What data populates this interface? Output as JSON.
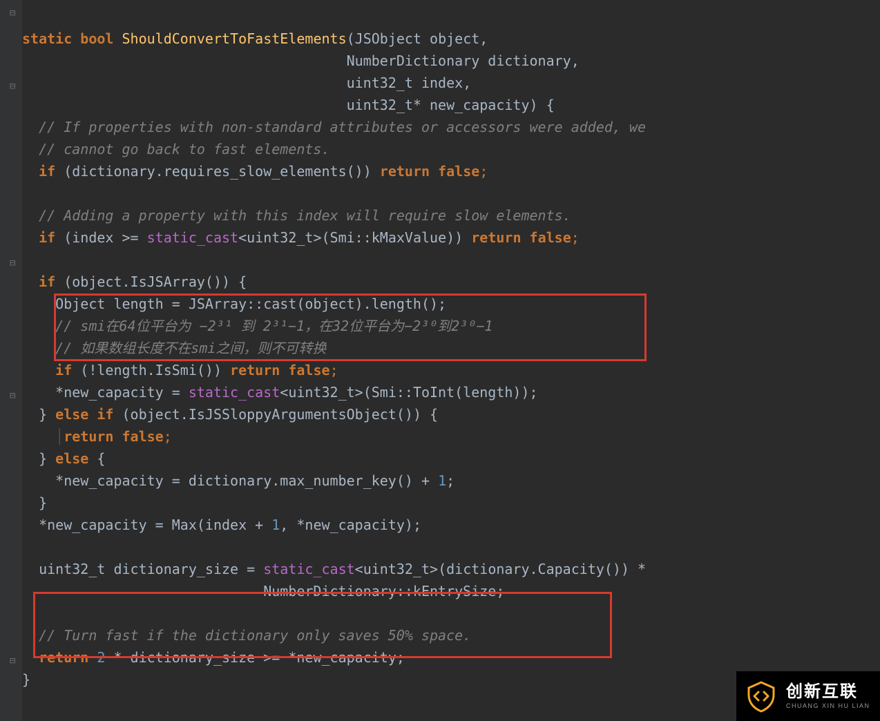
{
  "code": {
    "l1_a": "static",
    "l1_b": "bool",
    "l1_c": "ShouldConvertToFastElements",
    "l1_d": "(JSObject object,",
    "l2": "                                       NumberDictionary dictionary,",
    "l3": "                                       uint32_t index,",
    "l4": "                                       uint32_t* new_capacity) {",
    "l5": "  // If properties with non-standard attributes or accessors were added, we",
    "l6": "  // cannot go back to fast elements.",
    "l7a": "if",
    "l7b": " (dictionary.requires_slow_elements()) ",
    "l7c": "return",
    "l7d": "false",
    "l7e": ";",
    "l8": "",
    "l9": "  // Adding a property with this index will require slow elements.",
    "l10a": "if",
    "l10b": " (index >= ",
    "l10c": "static_cast",
    "l10d": "<uint32_t>(Smi::kMaxValue)) ",
    "l10e": "return",
    "l10f": "false",
    "l10g": ";",
    "l11": "",
    "l12a": "if",
    "l12b": " (object.IsJSArray()) {",
    "l13": "    Object length = JSArray::cast(object).length();",
    "l14": "    // smi在64位平台为 −2³¹ 到 2³¹−1，在32位平台为−2³⁰到2³⁰−1",
    "l15": "    // 如果数组长度不在smi之间，则不可转换",
    "l16a": "if",
    "l16b": " (!length.IsSmi()) ",
    "l16c": "return",
    "l16d": "false",
    "l16e": ";",
    "l17a": "    *new_capacity = ",
    "l17b": "static_cast",
    "l17c": "<uint32_t>(Smi::ToInt(length));",
    "l18a": "  } ",
    "l18b": "else if",
    "l18c": " (object.IsJSSloppyArgumentsObject()) {",
    "l19a": "return",
    "l19b": "false",
    "l19c": ";",
    "l20a": "  } ",
    "l20b": "else",
    "l20c": " {",
    "l21a": "    *new_capacity = dictionary.max_number_key() + ",
    "l21b": "1",
    "l21c": ";",
    "l22": "  }",
    "l23a": "  *new_capacity = Max(index + ",
    "l23b": "1",
    "l23c": ", *new_capacity);",
    "l24": "",
    "l25a": "  uint32_t dictionary_size = ",
    "l25b": "static_cast",
    "l25c": "<uint32_t>(dictionary.Capacity()) *",
    "l26": "                             NumberDictionary::kEntrySize;",
    "l27": "",
    "l28": "  // Turn fast if the dictionary only saves 50% space.",
    "l29a": "return",
    "l29b": "2",
    "l29c": " * dictionary_size >= *new_capacity;",
    "l30": "}",
    "guide": "    │"
  },
  "watermark": {
    "cn": "创新互联",
    "en": "CHUANG XIN HU LIAN"
  }
}
